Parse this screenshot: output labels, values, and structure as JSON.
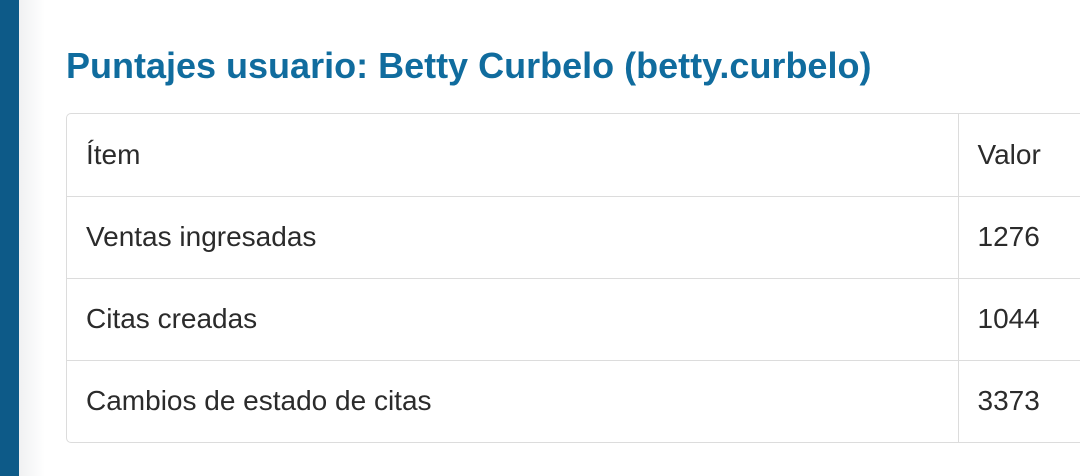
{
  "page": {
    "title": "Puntajes usuario: Betty Curbelo (betty.curbelo)"
  },
  "table": {
    "headers": {
      "item": "Ítem",
      "value": "Valor"
    },
    "rows": [
      {
        "item": "Ventas ingresadas",
        "value": "1276"
      },
      {
        "item": "Citas creadas",
        "value": "1044"
      },
      {
        "item": "Cambios de estado de citas",
        "value": "3373"
      }
    ]
  },
  "colors": {
    "sidebar": "#0d5a88",
    "title": "#106c9e",
    "border": "#dcdcdc",
    "text": "#2b2b2b"
  }
}
